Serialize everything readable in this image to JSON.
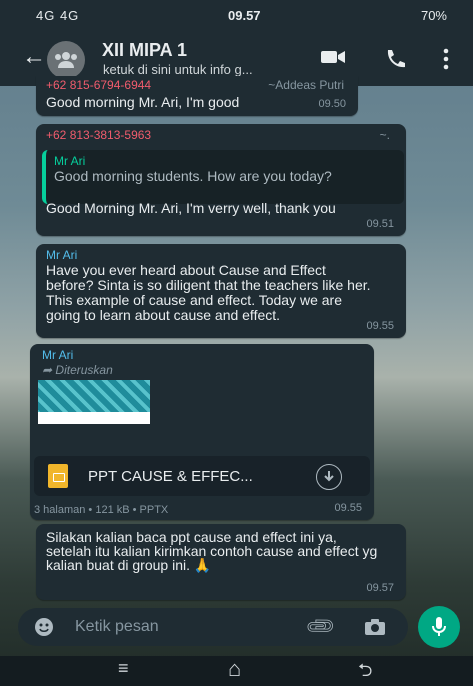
{
  "status_bar": {
    "network": "4G 4G",
    "time": "09.57",
    "battery": "70%"
  },
  "header": {
    "title": "XII MIPA 1",
    "subtitle": "ketuk di sini untuk info g..."
  },
  "messages": [
    {
      "phone": "+62 815-6794-6944",
      "name": "~Addeas Putri",
      "text": "Good morning Mr. Ari, I'm good",
      "time": "09.50"
    },
    {
      "phone": "+62 813-3813-5963",
      "name": "~.",
      "quote_sender": "Mr Ari",
      "quote_text": "Good morning students. How are you today?",
      "text": "Good Morning Mr. Ari, I'm verry well, thank you",
      "time": "09.51"
    },
    {
      "sender": "Mr Ari",
      "text": "Have you ever heard about Cause and Effect before? Sinta is so diligent that the teachers like her. This example of cause and effect. Today we are going to learn about cause and effect.",
      "time": "09.55"
    },
    {
      "sender": "Mr Ari",
      "forwarded": "Diteruskan",
      "file_name": "PPT CAUSE & EFFEC...",
      "file_meta": "3 halaman • 121 kB • PPTX",
      "time": "09.55"
    },
    {
      "text": "Silakan kalian baca ppt cause and effect ini ya, setelah itu kalian kirimkan contoh cause and effect yg kalian buat di group ini. 🙏",
      "time": "09.57"
    }
  ],
  "input": {
    "placeholder": "Ketik pesan"
  },
  "colors": {
    "accent": "#00a884",
    "header": "#1f2c33",
    "sender": "#53bdeb",
    "phone": "#f15c6d"
  },
  "icons": [
    "back-arrow-icon",
    "group-avatar-icon",
    "video-call-icon",
    "phone-call-icon",
    "more-icon",
    "forward-icon",
    "document-icon",
    "download-icon",
    "emoji-icon",
    "attach-icon",
    "camera-icon",
    "mic-icon"
  ]
}
